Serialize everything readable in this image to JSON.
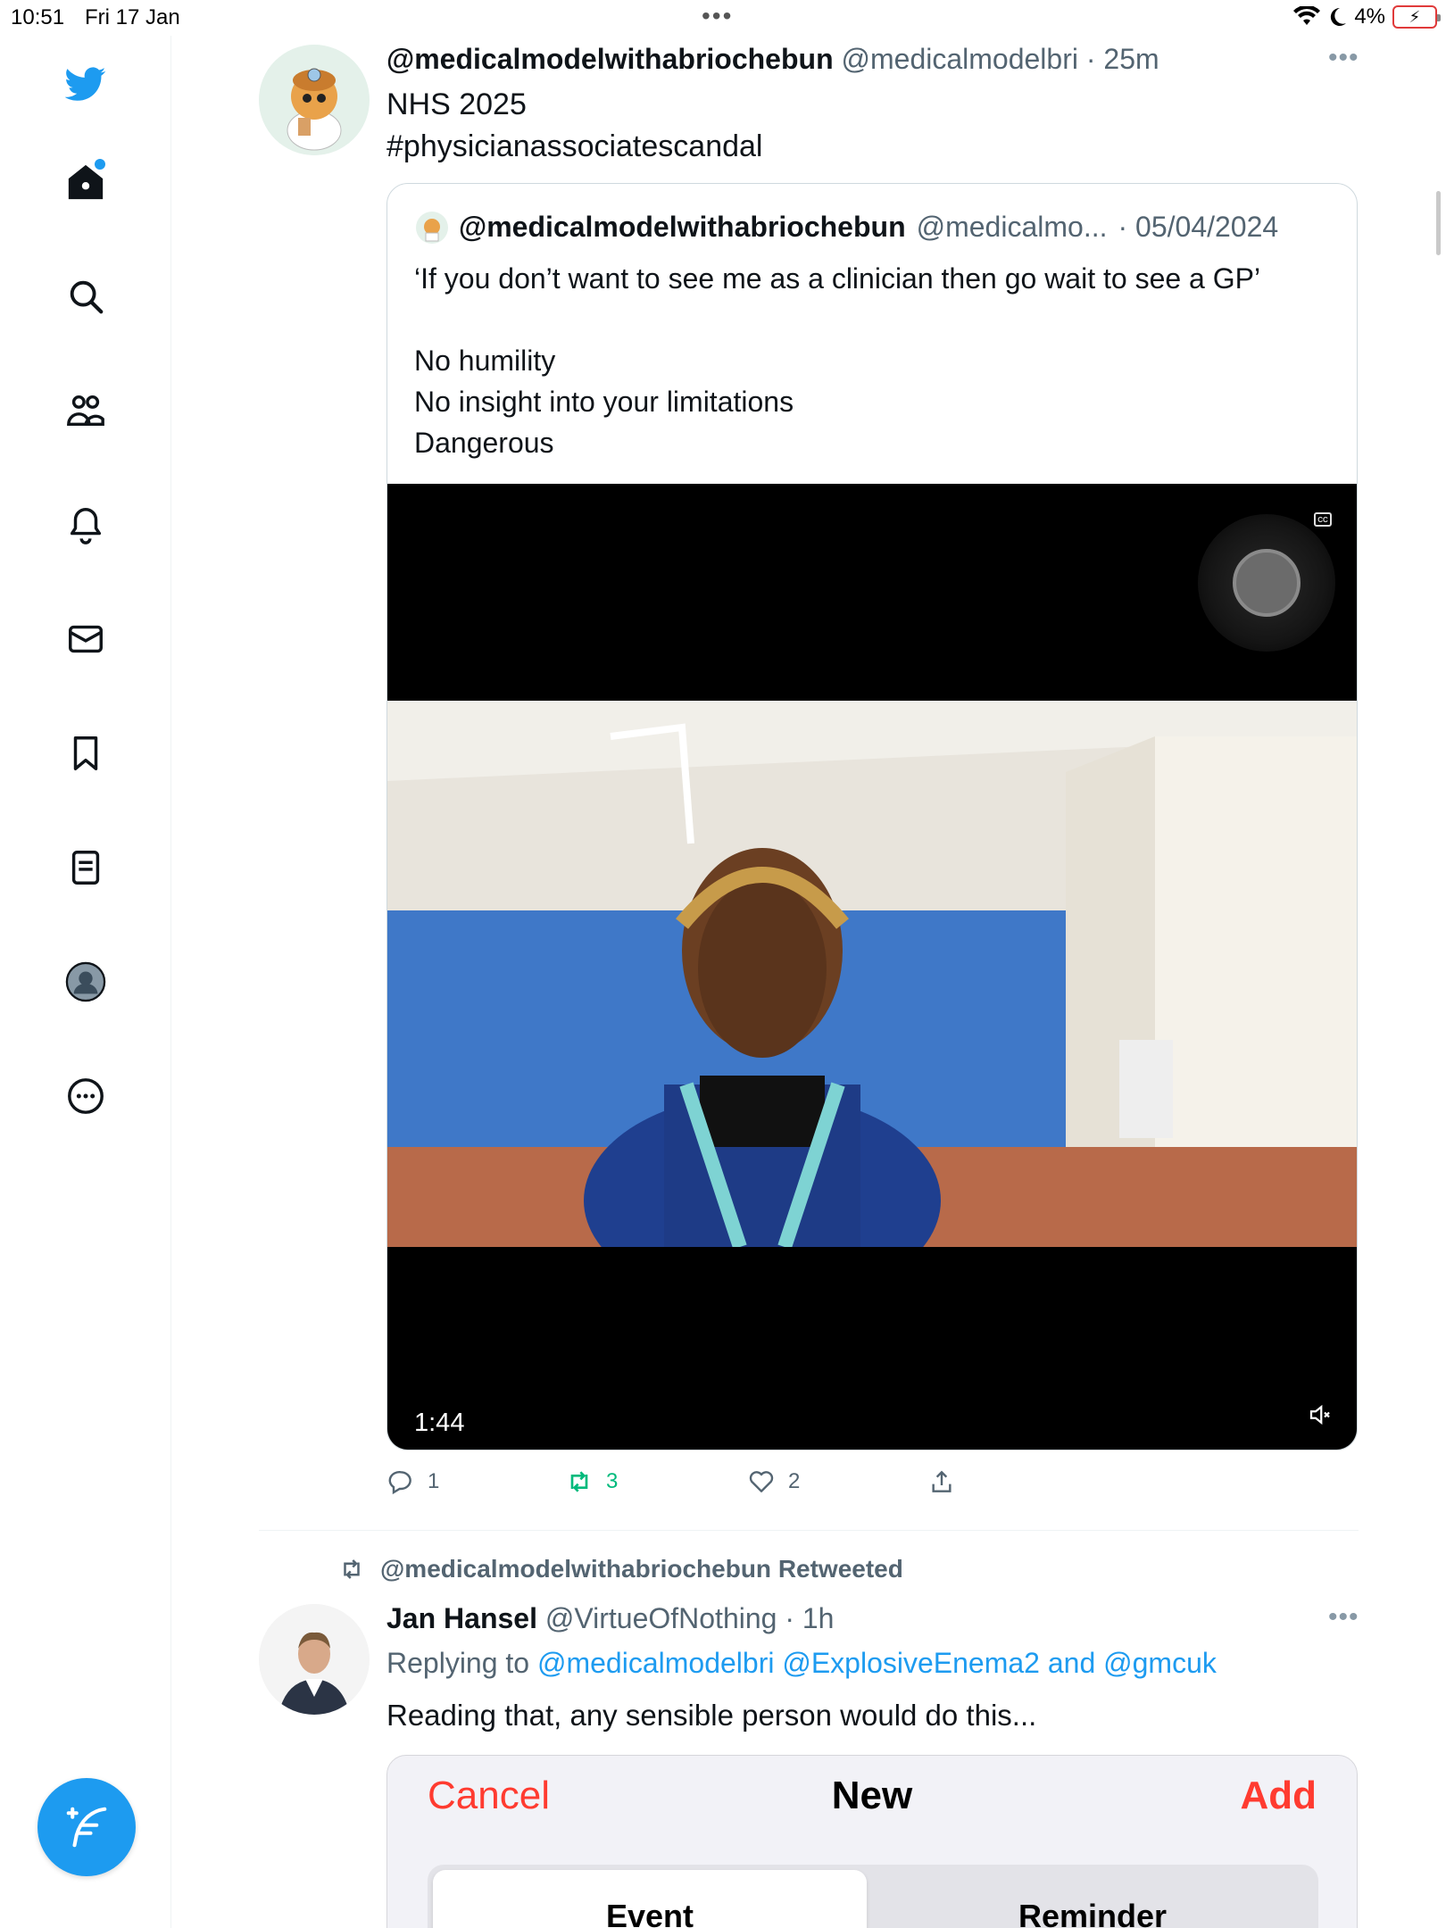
{
  "status_bar": {
    "time": "10:51",
    "date": "Fri 17 Jan",
    "battery": "4%"
  },
  "sidebar": {
    "items": [
      "twitter-logo",
      "home",
      "search",
      "communities",
      "notifications",
      "messages",
      "bookmarks",
      "lists",
      "profile",
      "more"
    ],
    "compose_icon": "feather-plus-icon",
    "accent": "#1d9bf0"
  },
  "tweet1": {
    "name": "@medicalmodelwithabriochebun",
    "handle": "@medicalmodelbri",
    "time": "· 25m",
    "text": "NHS 2025",
    "hashtag": "#physicianassociatescandal",
    "quote": {
      "name": "@medicalmodelwithabriochebun",
      "handle": "@medicalmo...",
      "date": "· 05/04/2024",
      "lines": [
        "‘If you don’t want to see me as a clinician then go wait to see a GP’",
        "No humility",
        "No insight into your limitations",
        "Dangerous"
      ],
      "video": {
        "duration": "1:44",
        "cc_label": "CC"
      }
    },
    "actions": {
      "replies": "1",
      "retweets": "3",
      "likes": "2"
    }
  },
  "tweet2": {
    "retweeted_by": "@medicalmodelwithabriochebun Retweeted",
    "name": "Jan Hansel",
    "handle": "@VirtueOfNothing",
    "time": "· 1h",
    "replying_prefix": "Replying to",
    "reply_to_1": "@medicalmodelbri",
    "reply_to_2": "@ExplosiveEnema2",
    "reply_and": "and",
    "reply_to_3": "@gmcuk",
    "text": "Reading that, any sensible person would do this..."
  },
  "sheet": {
    "cancel": "Cancel",
    "title": "New",
    "add": "Add",
    "segments": [
      "Event",
      "Reminder"
    ],
    "accent": "#ff3b30"
  }
}
